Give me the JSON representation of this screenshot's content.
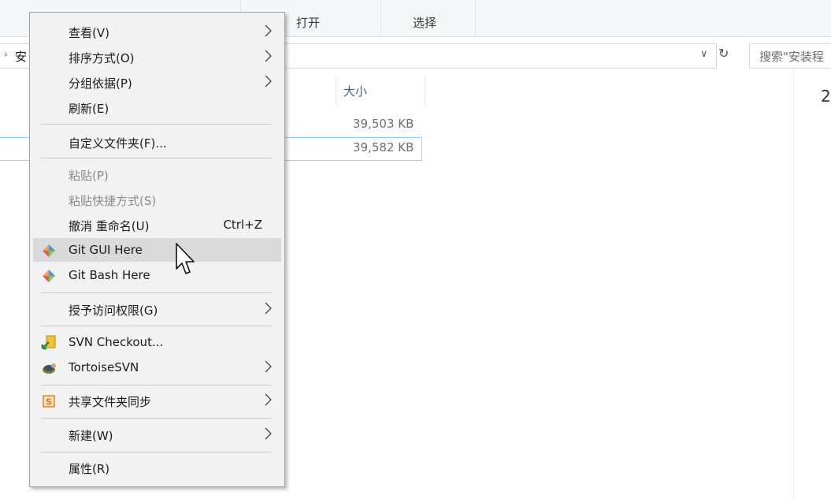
{
  "ribbon": {
    "open_label": "打开",
    "select_label": "选择"
  },
  "address": {
    "crumb": "安",
    "search_placeholder": "搜索\"安装程"
  },
  "file_list": {
    "column_size": "大小",
    "rows": [
      {
        "size": "39,503 KB"
      },
      {
        "size": "39,582 KB"
      }
    ],
    "right_pane_number": "2"
  },
  "context_menu": {
    "items": [
      {
        "label": "查看(V)",
        "submenu": true
      },
      {
        "label": "排序方式(O)",
        "submenu": true
      },
      {
        "label": "分组依据(P)",
        "submenu": true
      },
      {
        "label": "刷新(E)"
      },
      {
        "label": "自定义文件夹(F)..."
      },
      {
        "label": "粘贴(P)",
        "disabled": true
      },
      {
        "label": "粘贴快捷方式(S)",
        "disabled": true
      },
      {
        "label": "撤消 重命名(U)",
        "shortcut": "Ctrl+Z"
      },
      {
        "label": "Git GUI Here",
        "icon": "git-icon",
        "hovered": true
      },
      {
        "label": "Git Bash Here",
        "icon": "git-icon"
      },
      {
        "label": "授予访问权限(G)",
        "submenu": true
      },
      {
        "label": "SVN Checkout...",
        "icon": "svn-checkout-icon"
      },
      {
        "label": "TortoiseSVN",
        "icon": "tortoisesvn-icon",
        "submenu": true
      },
      {
        "label": "共享文件夹同步",
        "icon": "sync-share-icon",
        "submenu": true
      },
      {
        "label": "新建(W)",
        "submenu": true
      },
      {
        "label": "属性(R)"
      }
    ]
  },
  "colors": {
    "menu_bg": "#f2f2f2",
    "hover_bg": "#dadada",
    "selection_border": "#99d1ff"
  }
}
